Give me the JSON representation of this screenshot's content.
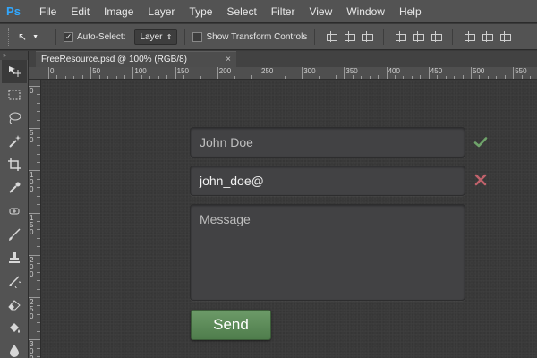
{
  "app": {
    "logo": "Ps",
    "menu": [
      "File",
      "Edit",
      "Image",
      "Layer",
      "Type",
      "Select",
      "Filter",
      "View",
      "Window",
      "Help"
    ]
  },
  "options_bar": {
    "move_tool_icon": "move-arrow-icon",
    "auto_select_label": "Auto-Select:",
    "auto_select_checked": true,
    "layer_select_value": "Layer",
    "show_transform_label": "Show Transform Controls",
    "show_transform_checked": false
  },
  "document": {
    "tab_title": "FreeResource.psd @ 100% (RGB/8)",
    "close_glyph": "×"
  },
  "toolbox": {
    "tools": [
      "move",
      "marquee",
      "lasso",
      "magic-wand",
      "crop",
      "eyedropper",
      "healing",
      "brush",
      "clone-stamp",
      "history-brush",
      "eraser",
      "paint-bucket",
      "blur"
    ]
  },
  "rulers": {
    "top": [
      "0",
      "50",
      "100",
      "150",
      "200",
      "250",
      "300",
      "350",
      "400",
      "450",
      "500",
      "550"
    ],
    "left": [
      "0",
      "50",
      "100",
      "150",
      "200",
      "250",
      "300"
    ]
  },
  "form": {
    "name_value": "John Doe",
    "email_value": "john_doe@",
    "message_placeholder": "Message",
    "send_label": "Send",
    "colors": {
      "valid": "#6fa36a",
      "invalid": "#c0626b",
      "button": "#5f8d5b"
    }
  }
}
